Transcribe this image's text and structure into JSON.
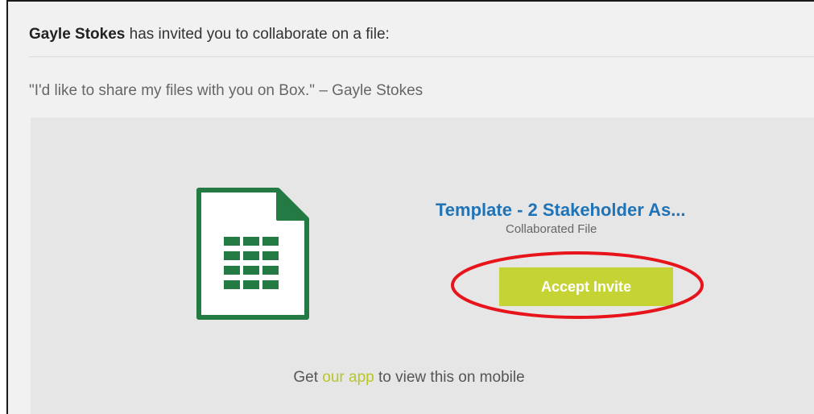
{
  "invite": {
    "inviter_name": "Gayle Stokes",
    "invite_text": " has invited you to collaborate on a file:",
    "message": "\"I'd like to share my files with you on Box.\" – Gayle Stokes"
  },
  "file": {
    "title": "Template - 2 Stakeholder As...",
    "subtitle": "Collaborated File",
    "icon": "spreadsheet-file-icon",
    "icon_color": "#237a43"
  },
  "actions": {
    "accept_label": "Accept Invite",
    "accept_color": "#c5d335",
    "highlight_color": "#e8141b"
  },
  "mobile": {
    "prefix": "Get ",
    "link_label": "our app",
    "suffix": " to view this on mobile",
    "link_color": "#b7c628"
  }
}
